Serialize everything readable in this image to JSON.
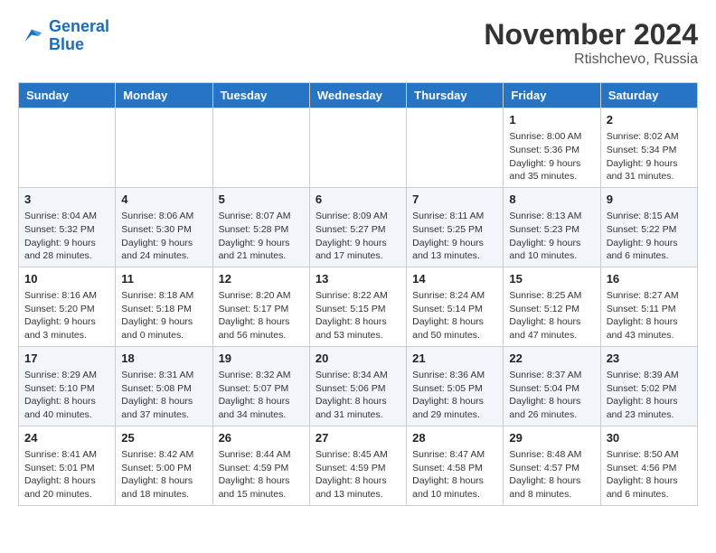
{
  "header": {
    "logo": {
      "line1": "General",
      "line2": "Blue"
    },
    "title": "November 2024",
    "location": "Rtishchevo, Russia"
  },
  "days_of_week": [
    "Sunday",
    "Monday",
    "Tuesday",
    "Wednesday",
    "Thursday",
    "Friday",
    "Saturday"
  ],
  "weeks": [
    [
      {
        "day": "",
        "info": ""
      },
      {
        "day": "",
        "info": ""
      },
      {
        "day": "",
        "info": ""
      },
      {
        "day": "",
        "info": ""
      },
      {
        "day": "",
        "info": ""
      },
      {
        "day": "1",
        "info": "Sunrise: 8:00 AM\nSunset: 5:36 PM\nDaylight: 9 hours\nand 35 minutes."
      },
      {
        "day": "2",
        "info": "Sunrise: 8:02 AM\nSunset: 5:34 PM\nDaylight: 9 hours\nand 31 minutes."
      }
    ],
    [
      {
        "day": "3",
        "info": "Sunrise: 8:04 AM\nSunset: 5:32 PM\nDaylight: 9 hours\nand 28 minutes."
      },
      {
        "day": "4",
        "info": "Sunrise: 8:06 AM\nSunset: 5:30 PM\nDaylight: 9 hours\nand 24 minutes."
      },
      {
        "day": "5",
        "info": "Sunrise: 8:07 AM\nSunset: 5:28 PM\nDaylight: 9 hours\nand 21 minutes."
      },
      {
        "day": "6",
        "info": "Sunrise: 8:09 AM\nSunset: 5:27 PM\nDaylight: 9 hours\nand 17 minutes."
      },
      {
        "day": "7",
        "info": "Sunrise: 8:11 AM\nSunset: 5:25 PM\nDaylight: 9 hours\nand 13 minutes."
      },
      {
        "day": "8",
        "info": "Sunrise: 8:13 AM\nSunset: 5:23 PM\nDaylight: 9 hours\nand 10 minutes."
      },
      {
        "day": "9",
        "info": "Sunrise: 8:15 AM\nSunset: 5:22 PM\nDaylight: 9 hours\nand 6 minutes."
      }
    ],
    [
      {
        "day": "10",
        "info": "Sunrise: 8:16 AM\nSunset: 5:20 PM\nDaylight: 9 hours\nand 3 minutes."
      },
      {
        "day": "11",
        "info": "Sunrise: 8:18 AM\nSunset: 5:18 PM\nDaylight: 9 hours\nand 0 minutes."
      },
      {
        "day": "12",
        "info": "Sunrise: 8:20 AM\nSunset: 5:17 PM\nDaylight: 8 hours\nand 56 minutes."
      },
      {
        "day": "13",
        "info": "Sunrise: 8:22 AM\nSunset: 5:15 PM\nDaylight: 8 hours\nand 53 minutes."
      },
      {
        "day": "14",
        "info": "Sunrise: 8:24 AM\nSunset: 5:14 PM\nDaylight: 8 hours\nand 50 minutes."
      },
      {
        "day": "15",
        "info": "Sunrise: 8:25 AM\nSunset: 5:12 PM\nDaylight: 8 hours\nand 47 minutes."
      },
      {
        "day": "16",
        "info": "Sunrise: 8:27 AM\nSunset: 5:11 PM\nDaylight: 8 hours\nand 43 minutes."
      }
    ],
    [
      {
        "day": "17",
        "info": "Sunrise: 8:29 AM\nSunset: 5:10 PM\nDaylight: 8 hours\nand 40 minutes."
      },
      {
        "day": "18",
        "info": "Sunrise: 8:31 AM\nSunset: 5:08 PM\nDaylight: 8 hours\nand 37 minutes."
      },
      {
        "day": "19",
        "info": "Sunrise: 8:32 AM\nSunset: 5:07 PM\nDaylight: 8 hours\nand 34 minutes."
      },
      {
        "day": "20",
        "info": "Sunrise: 8:34 AM\nSunset: 5:06 PM\nDaylight: 8 hours\nand 31 minutes."
      },
      {
        "day": "21",
        "info": "Sunrise: 8:36 AM\nSunset: 5:05 PM\nDaylight: 8 hours\nand 29 minutes."
      },
      {
        "day": "22",
        "info": "Sunrise: 8:37 AM\nSunset: 5:04 PM\nDaylight: 8 hours\nand 26 minutes."
      },
      {
        "day": "23",
        "info": "Sunrise: 8:39 AM\nSunset: 5:02 PM\nDaylight: 8 hours\nand 23 minutes."
      }
    ],
    [
      {
        "day": "24",
        "info": "Sunrise: 8:41 AM\nSunset: 5:01 PM\nDaylight: 8 hours\nand 20 minutes."
      },
      {
        "day": "25",
        "info": "Sunrise: 8:42 AM\nSunset: 5:00 PM\nDaylight: 8 hours\nand 18 minutes."
      },
      {
        "day": "26",
        "info": "Sunrise: 8:44 AM\nSunset: 4:59 PM\nDaylight: 8 hours\nand 15 minutes."
      },
      {
        "day": "27",
        "info": "Sunrise: 8:45 AM\nSunset: 4:59 PM\nDaylight: 8 hours\nand 13 minutes."
      },
      {
        "day": "28",
        "info": "Sunrise: 8:47 AM\nSunset: 4:58 PM\nDaylight: 8 hours\nand 10 minutes."
      },
      {
        "day": "29",
        "info": "Sunrise: 8:48 AM\nSunset: 4:57 PM\nDaylight: 8 hours\nand 8 minutes."
      },
      {
        "day": "30",
        "info": "Sunrise: 8:50 AM\nSunset: 4:56 PM\nDaylight: 8 hours\nand 6 minutes."
      }
    ]
  ]
}
